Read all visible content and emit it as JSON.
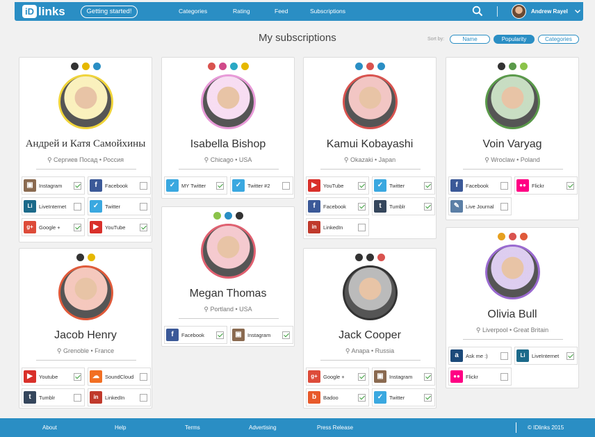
{
  "header": {
    "logo_box": "iD",
    "logo_text": "links",
    "cta": "Getting started!",
    "nav": [
      "Categories",
      "Rating",
      "Feed",
      "Subscriptions"
    ],
    "user_name": "Andrew Rayel",
    "icons": {
      "search": "search-icon",
      "caret": "chevron-down-icon"
    }
  },
  "page": {
    "title": "My subscriptions",
    "sort_label": "Sort by:",
    "sort_options": [
      "Name",
      "Popularity",
      "Categories"
    ],
    "sort_selected": "Popularity"
  },
  "profiles": [
    {
      "name": "Андрей и Катя Самойхины",
      "location": "Сергиев Посад • Россия",
      "accent": "#f0d43a",
      "chips": [
        {
          "icon": "eyes-icon",
          "color": "#333"
        },
        {
          "icon": "graduation-cap-icon",
          "color": "#e6b800"
        },
        {
          "icon": "plane-icon",
          "color": "#2a8ec4"
        }
      ],
      "services": [
        {
          "label": "Instagram",
          "icon": "instagram-icon",
          "checked": true
        },
        {
          "label": "Facebook",
          "icon": "facebook-icon",
          "checked": false
        },
        {
          "label": "LiveInternet",
          "icon": "liveinternet-icon",
          "checked": false
        },
        {
          "label": "Twitter",
          "icon": "twitter-icon",
          "checked": false
        },
        {
          "label": "Google +",
          "icon": "googleplus-icon",
          "checked": true
        },
        {
          "label": "YouTube",
          "icon": "youtube-icon",
          "checked": true
        }
      ]
    },
    {
      "name": "Jacob Henry",
      "location": "Grenoble • France",
      "accent": "#e05a3a",
      "chips": [
        {
          "icon": "sunglasses-icon",
          "color": "#333"
        },
        {
          "icon": "graduation-cap-icon",
          "color": "#e6b800"
        }
      ],
      "services": [
        {
          "label": "Youtube",
          "icon": "youtube-icon",
          "checked": true
        },
        {
          "label": "SoundCloud",
          "icon": "soundcloud-icon",
          "checked": false
        },
        {
          "label": "Tumblr",
          "icon": "tumblr-icon",
          "checked": false
        },
        {
          "label": "LinkedIn",
          "icon": "linkedin-icon",
          "checked": false
        }
      ]
    },
    {
      "name": "Isabella Bishop",
      "location": "Chicago • USA",
      "accent": "#e89ad8",
      "chips": [
        {
          "icon": "headphones-icon",
          "color": "#d9534f"
        },
        {
          "icon": "sparkle-icon",
          "color": "#d04a8a"
        },
        {
          "icon": "brush-icon",
          "color": "#2aa8c4"
        },
        {
          "icon": "smile-icon",
          "color": "#e6b800"
        }
      ],
      "services": [
        {
          "label": "MY Twitter",
          "icon": "twitter-icon",
          "checked": true
        },
        {
          "label": "Twitter #2",
          "icon": "twitter-icon",
          "checked": false
        }
      ]
    },
    {
      "name": "Megan Thomas",
      "location": "Portland • USA",
      "accent": "#e06070",
      "chips": [
        {
          "icon": "leaf-icon",
          "color": "#8bc34a"
        },
        {
          "icon": "chat-icon",
          "color": "#2a8ec4"
        },
        {
          "icon": "eyes-icon",
          "color": "#333"
        }
      ],
      "services": [
        {
          "label": "Facebook",
          "icon": "facebook-icon",
          "checked": true
        },
        {
          "label": "Instagram",
          "icon": "instagram-icon",
          "checked": true
        }
      ]
    },
    {
      "name": "Kamui Kobayashi",
      "location": "Okazaki • Japan",
      "accent": "#d9534f",
      "chips": [
        {
          "icon": "drop-icon",
          "color": "#2a8ec4"
        },
        {
          "icon": "car-icon",
          "color": "#d9534f"
        },
        {
          "icon": "plane-icon",
          "color": "#2a8ec4"
        }
      ],
      "services": [
        {
          "label": "YouTube",
          "icon": "youtube-icon",
          "checked": true
        },
        {
          "label": "Twitter",
          "icon": "twitter-icon",
          "checked": true
        },
        {
          "label": "Facebook",
          "icon": "facebook-icon",
          "checked": true
        },
        {
          "label": "Tumblr",
          "icon": "tumblr-icon",
          "checked": true
        },
        {
          "label": "LinkedIn",
          "icon": "linkedin-icon",
          "checked": false
        }
      ]
    },
    {
      "name": "Jack Cooper",
      "location": "Anapa • Russia",
      "accent": "#333333",
      "chips": [
        {
          "icon": "eyes-icon",
          "color": "#333"
        },
        {
          "icon": "skull-icon",
          "color": "#333"
        },
        {
          "icon": "heart-icon",
          "color": "#d9534f"
        }
      ],
      "services": [
        {
          "label": "Google +",
          "icon": "googleplus-icon",
          "checked": true
        },
        {
          "label": "Instagram",
          "icon": "instagram-icon",
          "checked": true
        },
        {
          "label": "Badoo",
          "icon": "badoo-icon",
          "checked": true
        },
        {
          "label": "Twitter",
          "icon": "twitter-icon",
          "checked": true
        }
      ]
    },
    {
      "name": "Voin Varyag",
      "location": "Wroclaw • Poland",
      "accent": "#5a9a4a",
      "chips": [
        {
          "icon": "eyes-icon",
          "color": "#333"
        },
        {
          "icon": "game-icon",
          "color": "#5a9a4a"
        },
        {
          "icon": "leaf-icon",
          "color": "#8bc34a"
        }
      ],
      "services": [
        {
          "label": "Facebook",
          "icon": "facebook-icon",
          "checked": false
        },
        {
          "label": "Flickr",
          "icon": "flickr-icon",
          "checked": true
        },
        {
          "label": "Live Journal",
          "icon": "livejournal-icon",
          "checked": false
        }
      ]
    },
    {
      "name": "Olivia Bull",
      "location": "Liverpool • Great Britain",
      "accent": "#9a6ad0",
      "chips": [
        {
          "icon": "chat-icon",
          "color": "#e6a020"
        },
        {
          "icon": "headphones-icon",
          "color": "#d9534f"
        },
        {
          "icon": "glasses-icon",
          "color": "#e05a3a"
        }
      ],
      "services": [
        {
          "label": "Ask me :)",
          "icon": "askfm-icon",
          "checked": false
        },
        {
          "label": "LiveInternet",
          "icon": "liveinternet-icon",
          "checked": true
        },
        {
          "label": "Flickr",
          "icon": "flickr-icon",
          "checked": false
        }
      ]
    }
  ],
  "footer": {
    "links": [
      "About",
      "Help",
      "Terms",
      "Advertising",
      "Press Release"
    ],
    "copyright": "© IDlinks 2015"
  }
}
